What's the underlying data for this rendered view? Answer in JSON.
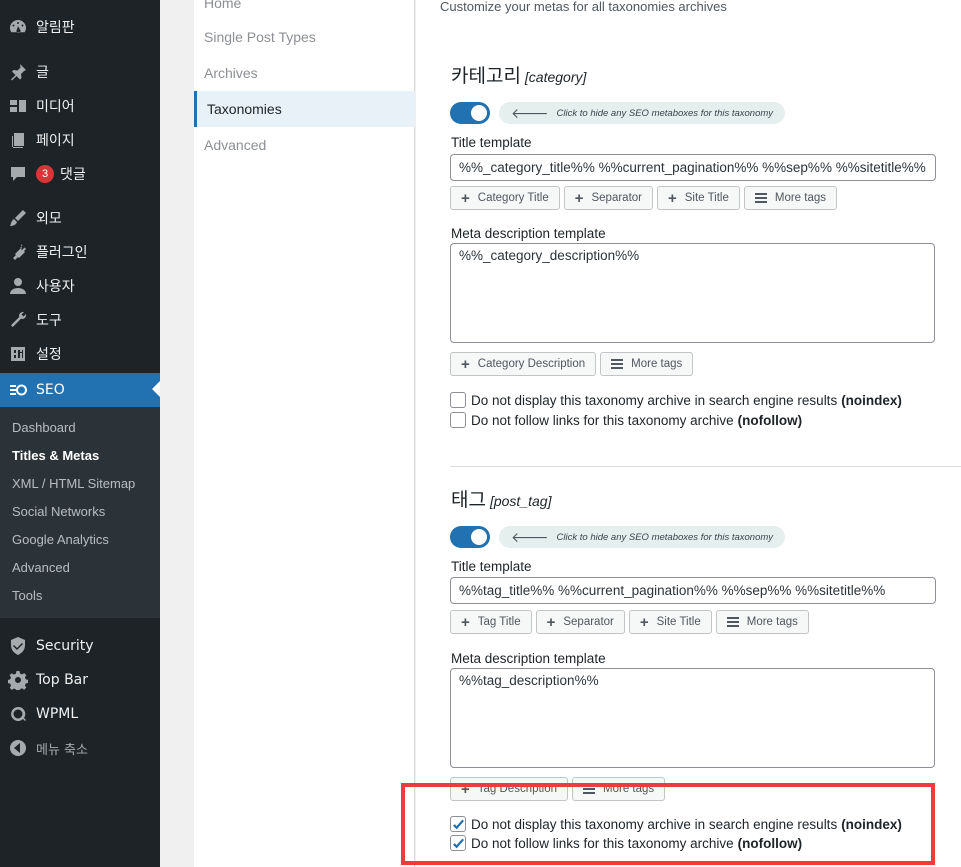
{
  "admin_menu": [
    {
      "icon": "dashboard-icon",
      "label": "알림판"
    },
    {
      "icon": "pin-icon",
      "label": "글"
    },
    {
      "icon": "media-icon",
      "label": "미디어"
    },
    {
      "icon": "page-icon",
      "label": "페이지"
    },
    {
      "icon": "comment-icon",
      "label": "댓글",
      "badge": "3"
    },
    {
      "icon": "brush-icon",
      "label": "외모"
    },
    {
      "icon": "plugin-icon",
      "label": "플러그인"
    },
    {
      "icon": "user-icon",
      "label": "사용자"
    },
    {
      "icon": "wrench-icon",
      "label": "도구"
    },
    {
      "icon": "settings-icon",
      "label": "설정"
    },
    {
      "icon": "seo-icon",
      "label": "SEO"
    }
  ],
  "seo_submenu": [
    "Dashboard",
    "Titles & Metas",
    "XML / HTML Sitemap",
    "Social Networks",
    "Google Analytics",
    "Advanced",
    "Tools"
  ],
  "extra_menu": [
    {
      "icon": "shield-icon",
      "label": "Security"
    },
    {
      "icon": "gear-icon",
      "label": "Top Bar"
    },
    {
      "icon": "wpml-icon",
      "label": "WPML"
    },
    {
      "icon": "collapse-icon",
      "label": "메뉴 축소"
    }
  ],
  "tabs": [
    "Home",
    "Single Post Types",
    "Archives",
    "Taxonomies",
    "Advanced"
  ],
  "description": "Customize your metas for all taxonomies archives",
  "sections": [
    {
      "title": "카테고리",
      "slug": "[category]",
      "hint": "Click to hide any SEO metaboxes for this taxonomy",
      "title_label": "Title template",
      "title_value": "%%_category_title%% %%current_pagination%% %%sep%% %%sitetitle%%",
      "title_tags": [
        "Category Title",
        "Separator",
        "Site Title"
      ],
      "more_tags": "More tags",
      "meta_label": "Meta description template",
      "meta_value": "%%_category_description%%",
      "meta_tags": [
        "Category Description"
      ],
      "noindex_text": "Do not display this taxonomy archive in search engine results",
      "noindex_bold": "(noindex)",
      "nofollow_text": "Do not follow links for this taxonomy archive",
      "nofollow_bold": "(nofollow)"
    },
    {
      "title": "태그",
      "slug": "[post_tag]",
      "hint": "Click to hide any SEO metaboxes for this taxonomy",
      "title_label": "Title template",
      "title_value": "%%tag_title%% %%current_pagination%% %%sep%% %%sitetitle%%",
      "title_tags": [
        "Tag Title",
        "Separator",
        "Site Title"
      ],
      "more_tags": "More tags",
      "meta_label": "Meta description template",
      "meta_value": "%%tag_description%%",
      "meta_tags": [
        "Tag Description"
      ],
      "noindex_text": "Do not display this taxonomy archive in search engine results",
      "noindex_bold": "(noindex)",
      "nofollow_text": "Do not follow links for this taxonomy archive",
      "nofollow_bold": "(nofollow)"
    }
  ],
  "colors": {
    "sidebar": "#1d2327",
    "submenu": "#2c3338",
    "accent": "#2271b1",
    "highlight": "#ee3b3b"
  }
}
